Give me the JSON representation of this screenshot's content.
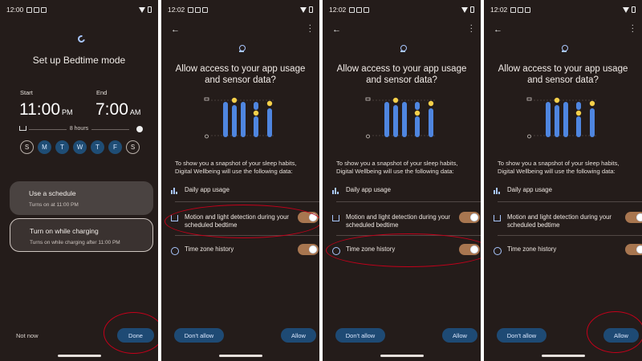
{
  "screens": {
    "setup": {
      "status_time": "12:00",
      "title": "Set up Bedtime mode",
      "start_label": "Start",
      "start_time": "11:00",
      "start_ampm": "PM",
      "end_label": "End",
      "end_time": "7:00",
      "end_ampm": "AM",
      "duration": "8 hours",
      "days": [
        {
          "letter": "S",
          "on": false
        },
        {
          "letter": "M",
          "on": true
        },
        {
          "letter": "T",
          "on": true
        },
        {
          "letter": "W",
          "on": true
        },
        {
          "letter": "T",
          "on": true
        },
        {
          "letter": "F",
          "on": true
        },
        {
          "letter": "S",
          "on": false
        }
      ],
      "schedule_title": "Use a schedule",
      "schedule_sub": "Turns on at 11:00 PM",
      "charging_title": "Turn on while charging",
      "charging_sub": "Turns on while charging after 11:00 PM",
      "not_now": "Not now",
      "done": "Done"
    },
    "permission": {
      "status_time": "12:02",
      "title": "Allow access to your app usage and sensor data?",
      "description": "To show you a snapshot of your sleep habits, Digital Wellbeing will use the following data:",
      "items": {
        "app_usage": "Daily app usage",
        "motion": "Motion and light detection during your scheduled bedtime",
        "timezone": "Time zone history"
      },
      "dont_allow": "Don't allow",
      "allow": "Allow"
    }
  },
  "colors": {
    "background": "#241c1a",
    "accent": "#1e4a74",
    "toggle_on": "#a87650",
    "annotation_ring": "#c4001a",
    "bar_blue": "#4f86e0",
    "dot_yellow": "#f5d04a"
  },
  "icons": [
    "moon-icon",
    "back-arrow-icon",
    "more-vert-icon",
    "sleep-pin-icon",
    "bar-chart-icon",
    "bed-icon",
    "clock-icon",
    "sun-icon"
  ]
}
